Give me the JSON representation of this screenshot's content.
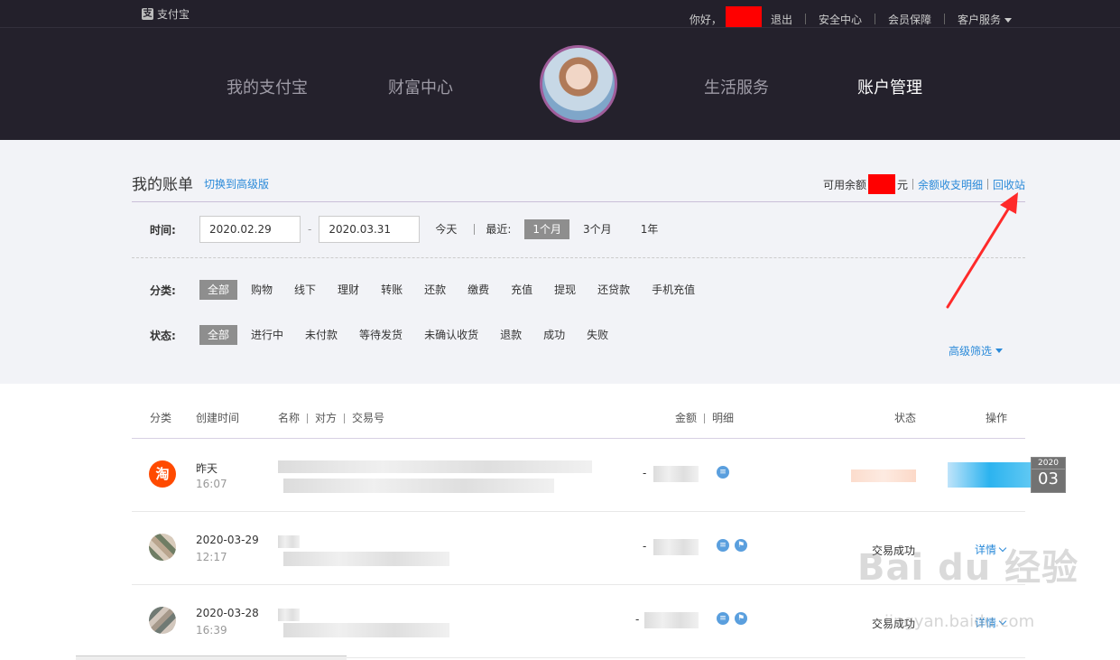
{
  "topbar": {
    "brand": "支付宝",
    "greeting": "你好，",
    "links": [
      "退出",
      "安全中心",
      "会员保障",
      "客户服务"
    ]
  },
  "nav": {
    "items": [
      "我的支付宝",
      "财富中心",
      "生活服务",
      "账户管理"
    ],
    "active": "账户管理"
  },
  "bill": {
    "title": "我的账单",
    "switch_label": "切换到高级版",
    "balance_label": "可用余额",
    "balance_unit": "元",
    "balance_detail_link": "余额收支明细",
    "recycle_link": "回收站"
  },
  "filters": {
    "time_label": "时间:",
    "start_date": "2020.02.29",
    "dash": "-",
    "end_date": "2020.03.31",
    "today": "今天",
    "recent_label": "最近:",
    "recent_options": [
      "1个月",
      "3个月",
      "1年"
    ],
    "category_label": "分类:",
    "categories": [
      "全部",
      "购物",
      "线下",
      "理财",
      "转账",
      "还款",
      "缴费",
      "充值",
      "提现",
      "还贷款",
      "手机充值"
    ],
    "status_label": "状态:",
    "statuses": [
      "全部",
      "进行中",
      "未付款",
      "等待发货",
      "未确认收货",
      "退款",
      "成功",
      "失败"
    ],
    "advanced_filter": "高级筛选"
  },
  "table": {
    "headers": {
      "category": "分类",
      "created": "创建时间",
      "name": "名称",
      "counterparty": "对方",
      "trade_no": "交易号",
      "amount": "金额",
      "detail": "明细",
      "status": "状态",
      "action": "操作"
    },
    "rows": [
      {
        "icon_text": "淘",
        "date": "昨天",
        "time": "16:07",
        "minus": "-",
        "status": "",
        "action": ""
      },
      {
        "icon_text": "",
        "date": "2020-03-29",
        "time": "12:17",
        "minus": "-",
        "status": "交易成功",
        "action": "详情"
      },
      {
        "icon_text": "",
        "date": "2020-03-28",
        "time": "16:39",
        "minus": "-",
        "status": "交易成功",
        "action": "详情"
      }
    ]
  },
  "calendar_badge": {
    "year": "2020",
    "month": "03"
  },
  "watermark": {
    "main": "Bai du 经验",
    "sub": "jingyan.baidu.com"
  },
  "colors": {
    "accent": "#2a8ad9",
    "nav_bg": "#24212c",
    "redaction": "#ff0000",
    "selected_chip": "#8e8e8e"
  }
}
